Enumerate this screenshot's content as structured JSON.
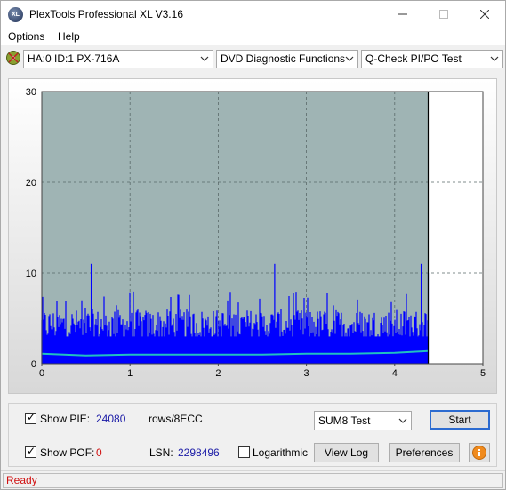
{
  "window": {
    "title": "PlexTools Professional XL V3.16",
    "app_icon_text": "XL"
  },
  "menu": {
    "options_label": "Options",
    "help_label": "Help"
  },
  "toolbar": {
    "drive": "HA:0 ID:1  PX-716A",
    "function": "DVD Diagnostic Functions",
    "test": "Q-Check PI/PO Test"
  },
  "chart_data": {
    "type": "area",
    "title": "",
    "xlabel": "",
    "ylabel": "",
    "xlim": [
      0,
      5
    ],
    "ylim": [
      0,
      30
    ],
    "x_ticks": [
      "0",
      "1",
      "2",
      "3",
      "4",
      "5"
    ],
    "y_ticks": [
      "0",
      "10",
      "20",
      "30"
    ],
    "grid": true,
    "data_end_x": 4.38,
    "series": [
      {
        "color": "#0000ff",
        "style": "dense spikes",
        "typical_max": 6,
        "peaks": [
          {
            "x": 0.56,
            "y": 11
          },
          {
            "x": 2.64,
            "y": 11
          },
          {
            "x": 4.3,
            "y": 11
          },
          {
            "x": 4.38,
            "y": 10
          }
        ]
      },
      {
        "color": "#20c0c0",
        "style": "line",
        "x": [
          0,
          0.5,
          1,
          1.5,
          2,
          2.5,
          3,
          3.5,
          4,
          4.38
        ],
        "y": [
          1.1,
          0.9,
          1.0,
          1.0,
          1.0,
          1.0,
          1.1,
          1.1,
          1.2,
          1.4
        ]
      }
    ],
    "background_color": "#9fb4b4",
    "end_region_color": "#ffffff"
  },
  "controls": {
    "show_pie_label": "Show PIE:",
    "show_pie_value": "24080",
    "rows_label": "rows/8ECC",
    "show_pof_label": "Show POF:",
    "show_pof_value": "0",
    "lsn_label": "LSN:",
    "lsn_value": "2298496",
    "logarithmic_label": "Logarithmic",
    "sum_select": "SUM8 Test",
    "start_button": "Start",
    "view_log_button": "View Log",
    "preferences_button": "Preferences"
  },
  "status": {
    "text": "Ready"
  }
}
